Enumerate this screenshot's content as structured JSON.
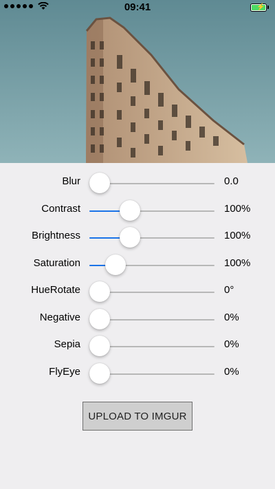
{
  "status_bar": {
    "time": "09:41",
    "signal_dots": 5,
    "battery_level": 1.0,
    "battery_color": "#4cd964"
  },
  "photo": {
    "subject": "building-photo",
    "sky_color": "#7aa2aa"
  },
  "sliders": [
    {
      "label": "Blur",
      "value": "0.0",
      "position": 0.0
    },
    {
      "label": "Contrast",
      "value": "100%",
      "position": 0.29
    },
    {
      "label": "Brightness",
      "value": "100%",
      "position": 0.29
    },
    {
      "label": "Saturation",
      "value": "100%",
      "position": 0.15
    },
    {
      "label": "HueRotate",
      "value": "0°",
      "position": 0.0
    },
    {
      "label": "Negative",
      "value": "0%",
      "position": 0.0
    },
    {
      "label": "Sepia",
      "value": "0%",
      "position": 0.0
    },
    {
      "label": "FlyEye",
      "value": "0%",
      "position": 0.0
    }
  ],
  "accent_color": "#1a73e8",
  "upload_button": {
    "label": "UPLOAD TO IMGUR"
  }
}
